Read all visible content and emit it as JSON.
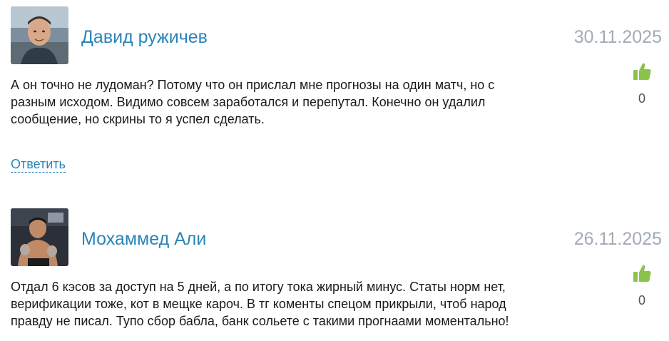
{
  "comments": [
    {
      "author": "Давид ружичев",
      "date": "30.11.2025",
      "text": "А он точно не лудоман? Потому что он прислал мне прогнозы на один матч, но с\nразным исходом. Видимо совсем заработался и перепутал. Конечно он удалил\nсообщение, но скрины то я успел сделать.",
      "likes": "0",
      "reply_label": "Ответить",
      "like_icon": "thumbs-up-icon"
    },
    {
      "author": "Мохаммед Али",
      "date": "26.11.2025",
      "text": "Отдал 6 кэсов за доступ на 5 дней, а по итогу тока жирный минус. Статы норм нет,\nверификации тоже, кот в мещке кароч. В тг коменты спецом прикрыли, чтоб народ\nправду не писал. Тупо сбор бабла, банк сольете с такими прогнаами моментально!",
      "likes": "0",
      "like_icon": "thumbs-up-icon"
    }
  ],
  "colors": {
    "author": "#2a84b8",
    "date": "#a3abb5",
    "like": "#8bc34a",
    "text": "#1a1a1a"
  }
}
